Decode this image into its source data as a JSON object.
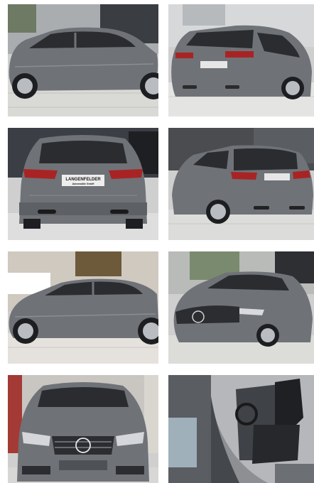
{
  "gallery": {
    "plate_text_line1": "LANGENFELDER",
    "plate_text_line2": "Automobile GmbH",
    "car_color": "#6f7277",
    "photos": [
      {
        "view": "side-left"
      },
      {
        "view": "rear-right"
      },
      {
        "view": "rear"
      },
      {
        "view": "rear-left"
      },
      {
        "view": "side-left"
      },
      {
        "view": "front-left"
      },
      {
        "view": "front"
      },
      {
        "view": "interior-driver-door-open"
      }
    ]
  }
}
